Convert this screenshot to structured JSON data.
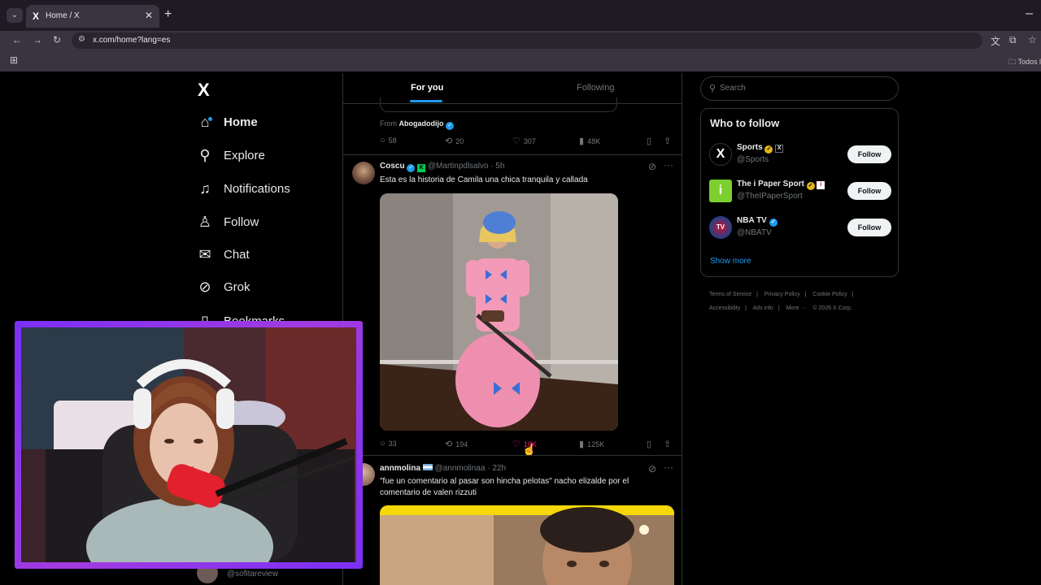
{
  "browser": {
    "tab_title": "Home / X",
    "tab_favicon": "X",
    "url": "x.com/home?lang=es",
    "bookmarks_folder": "Todos l"
  },
  "nav": {
    "logo": "X",
    "items": [
      {
        "label": "Home",
        "icon": "home-icon"
      },
      {
        "label": "Explore",
        "icon": "search-icon"
      },
      {
        "label": "Notifications",
        "icon": "bell-icon"
      },
      {
        "label": "Follow",
        "icon": "person-add-icon"
      },
      {
        "label": "Chat",
        "icon": "mail-icon"
      },
      {
        "label": "Grok",
        "icon": "grok-icon"
      },
      {
        "label": "Bookmarks",
        "icon": "bookmark-icon"
      }
    ],
    "profile_handle": "@sofitareview"
  },
  "feed": {
    "tabs": [
      "For you",
      "Following"
    ],
    "prev_post": {
      "from_label": "From",
      "from_name": "Abogadodijo",
      "stats": {
        "replies": "58",
        "reposts": "20",
        "likes": "307",
        "views": "48K"
      }
    },
    "post1": {
      "name": "Coscu",
      "handle": "@Martinpdlsalvo",
      "time": "· 5h",
      "text": "Esta es la historia de Camila una chica tranquila y callada",
      "stats": {
        "replies": "33",
        "reposts": "194",
        "likes": "10K",
        "views": "125K"
      }
    },
    "post2": {
      "name": "annmolina",
      "handle": "@annmolinaa",
      "time": "· 22h",
      "text": "\"fue un comentario al pasar son hincha pelotas\" nacho elizalde por el comentario de valen rizzuti"
    }
  },
  "sidebar_right": {
    "search_placeholder": "Search",
    "who_to_follow_title": "Who to follow",
    "accounts": [
      {
        "name": "Sports",
        "handle": "@Sports",
        "button": "Follow"
      },
      {
        "name": "The i Paper Sport",
        "handle": "@TheIPaperSport",
        "button": "Follow"
      },
      {
        "name": "NBA TV",
        "handle": "@NBATV",
        "button": "Follow"
      }
    ],
    "show_more": "Show more",
    "footer": [
      "Terms of Service",
      "|",
      "Privacy Policy",
      "|",
      "Cookie Policy",
      "|",
      "Accessibility",
      "|",
      "Ads info",
      "|",
      "More ···",
      "© 2026 X Corp."
    ]
  },
  "colors": {
    "accent": "#1d9bf0",
    "like": "#f91880",
    "cam_border": "#a23be0",
    "follow_btn": "#eff3f4"
  }
}
